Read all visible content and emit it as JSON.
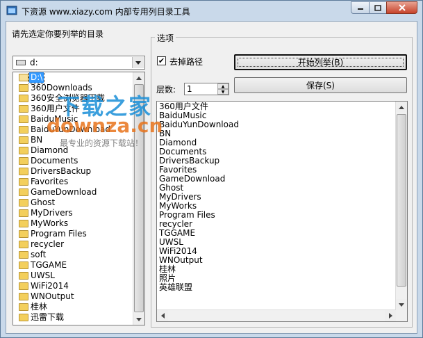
{
  "window": {
    "title": "下资源 www.xiazy.com 内部专用列目录工具",
    "colors": {
      "accent": "#3399ff",
      "close": "#c7432b"
    }
  },
  "left": {
    "prompt": "请先选定你要列举的目录",
    "drive_value": "d:",
    "dir_list": [
      {
        "name": "D:\\",
        "selected": true
      },
      {
        "name": "360Downloads"
      },
      {
        "name": "360安全浏览器下载"
      },
      {
        "name": "360用户文件"
      },
      {
        "name": "BaiduMusic"
      },
      {
        "name": "BaiduYunDownload"
      },
      {
        "name": "BN"
      },
      {
        "name": "Diamond"
      },
      {
        "name": "Documents"
      },
      {
        "name": "DriversBackup"
      },
      {
        "name": "Favorites"
      },
      {
        "name": "GameDownload"
      },
      {
        "name": "Ghost"
      },
      {
        "name": "MyDrivers"
      },
      {
        "name": "MyWorks"
      },
      {
        "name": "Program Files"
      },
      {
        "name": "recycler"
      },
      {
        "name": "soft"
      },
      {
        "name": "TGGAME"
      },
      {
        "name": "UWSL"
      },
      {
        "name": "WiFi2014"
      },
      {
        "name": "WNOutput"
      },
      {
        "name": "桂林"
      },
      {
        "name": "迅雷下载"
      }
    ]
  },
  "options": {
    "group_label": "选项",
    "remove_path_label": "去掉路径",
    "remove_path_checked": true,
    "start_button": "开始列举(B)",
    "save_button": "保存(S)",
    "level_label": "层数:",
    "level_value": "1"
  },
  "output": {
    "lines": [
      "360用户文件",
      "BaiduMusic",
      "BaiduYunDownload",
      "BN",
      "Diamond",
      "Documents",
      "DriversBackup",
      "Favorites",
      "GameDownload",
      "Ghost",
      "MyDrivers",
      "MyWorks",
      "Program Files",
      "recycler",
      "TGGAME",
      "UWSL",
      "WiFi2014",
      "WNOutput",
      "桂林",
      "照片",
      "英雄联盟"
    ]
  },
  "watermark": {
    "line1": "下载之家",
    "line2": "downza.cn",
    "line3": "最专业的资源下载站！"
  }
}
